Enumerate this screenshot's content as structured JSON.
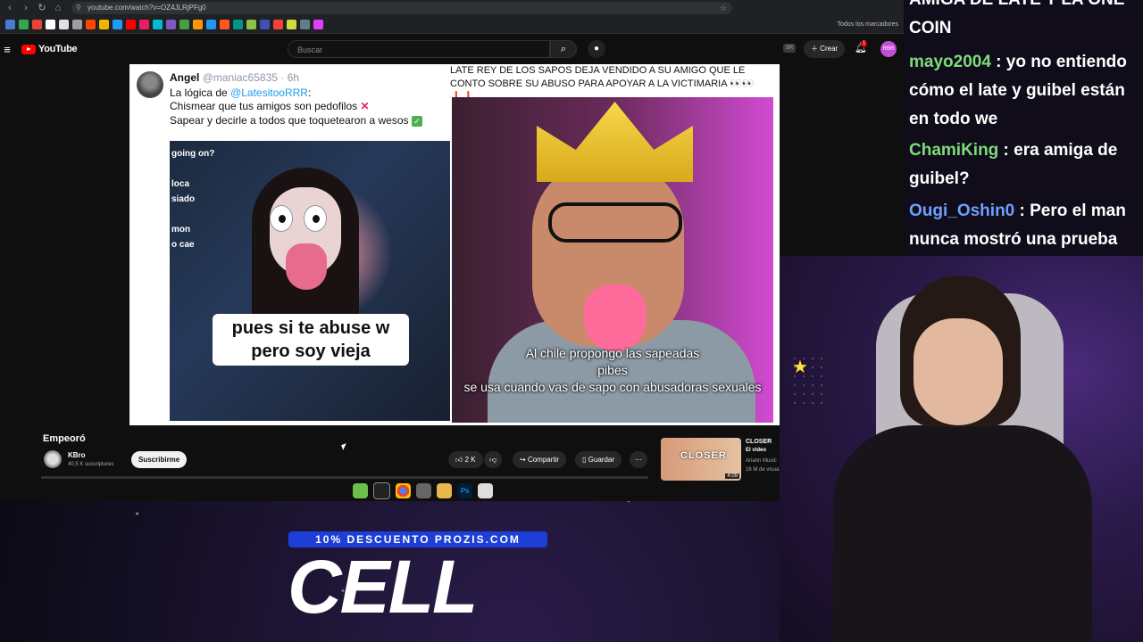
{
  "browser": {
    "url": "youtube.com/watch?v=OZ4JLRjPFg0",
    "bookmarks_all": "Todos los marcadores"
  },
  "youtube": {
    "logo": "YouTube",
    "search_placeholder": "Buscar",
    "create_label": "Crear",
    "notifications_count": "1",
    "avatar_text": "RBR"
  },
  "video_frame": {
    "tweet_name": "Angel",
    "tweet_handle": "@maniac65835 · 6h",
    "tweet_line1_prefix": "La lógica de ",
    "tweet_line1_link": "@LatesitooRRR",
    "tweet_line1_suffix": ":",
    "tweet_line2": "Chismear que tus amigos son pedofilos",
    "tweet_line3": "Sapear y decirle a todos que toquetearon a wesos",
    "headline": "LATE REY DE LOS SAPOS DEJA VENDIDO A SU AMIGO QUE LE CONTO SOBRE SU ABUSO PARA APOYAR A LA VICTIMARIA 👀👀❗❗",
    "left_side_text": [
      "going on?",
      "loca",
      "siado",
      "mon",
      "o cae"
    ],
    "left_caption": "pues si te abuse w pero soy vieja",
    "right_caption_1": "Al chile propongo las sapeadas",
    "right_caption_2": "pibes",
    "right_caption_3": "se usa cuando vas de sapo con abusadoras sexuales"
  },
  "video_info": {
    "title": "Empeoró",
    "channel": "KBro",
    "subscribers": "40,5 K suscriptores",
    "subscribe_label": "Suscribirme",
    "likes": "2 K",
    "share_label": "Compartir",
    "save_label": "Guardar"
  },
  "recommendation": {
    "thumb_text": "CLOSER",
    "duration": "4:09",
    "title": "CLOSER",
    "line2": "El video",
    "channel": "Ariann Music",
    "views": "16 M de visua"
  },
  "promo": {
    "badge": "10% DESCUENTO PROZIS.COM",
    "big": "CELL"
  },
  "chat": [
    {
      "user": "",
      "color": "#ffffff",
      "text": "AMIGA DE LATE Y LA ONE COIN"
    },
    {
      "user": "mayo2004",
      "color": "#7ddc7a",
      "text": " : yo no entiendo cómo el late y guibel están en todo we"
    },
    {
      "user": "ChamiKing",
      "color": "#7ddc7a",
      "text": " : era amiga de guibel?"
    },
    {
      "user": "Ougi_Oshin0",
      "color": "#6ea0ff",
      "text": " : Pero el man nunca mostró una prueba"
    }
  ]
}
